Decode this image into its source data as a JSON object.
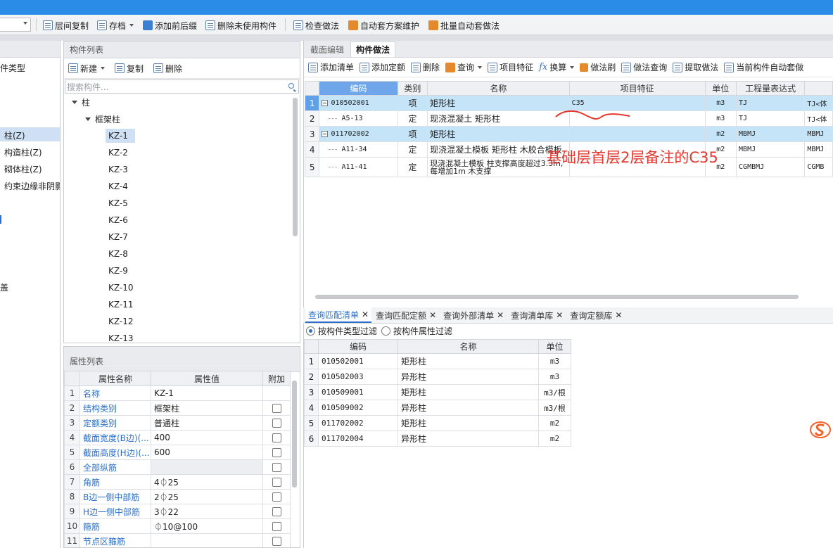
{
  "toolbar": {
    "items": [
      {
        "label": "层间复制",
        "icon": "copy-layers-icon"
      },
      {
        "label": "存档",
        "icon": "archive-icon"
      },
      {
        "label": "添加前后缀",
        "icon": "add-prefix-icon"
      },
      {
        "label": "删除未使用构件",
        "icon": "delete-unused-icon"
      },
      {
        "label": "检查做法",
        "icon": "check-method-icon"
      },
      {
        "label": "自动套方案维护",
        "icon": "auto-scheme-icon"
      },
      {
        "label": "批量自动套做法",
        "icon": "batch-auto-icon"
      }
    ]
  },
  "left_strip": {
    "items": [
      "件类型",
      "柱(Z)",
      "构造柱(Z)",
      "砌体柱(Z)",
      "约束边缘非阴影",
      "盖"
    ]
  },
  "component_list": {
    "title": "构件列表",
    "new_label": "新建",
    "copy_label": "复制",
    "delete_label": "删除",
    "search_placeholder": "搜索构件...",
    "root": "柱",
    "group": "框架柱",
    "items": [
      "KZ-1",
      "KZ-2",
      "KZ-3",
      "KZ-4",
      "KZ-5",
      "KZ-6",
      "KZ-7",
      "KZ-8",
      "KZ-9",
      "KZ-10",
      "KZ-11",
      "KZ-12",
      "KZ-13"
    ]
  },
  "attributes": {
    "title": "属性列表",
    "headers": [
      "属性名称",
      "属性值",
      "附加"
    ],
    "rows": [
      {
        "n": "1",
        "name": "名称",
        "value": "KZ-1"
      },
      {
        "n": "2",
        "name": "结构类别",
        "value": "框架柱"
      },
      {
        "n": "3",
        "name": "定额类别",
        "value": "普通柱"
      },
      {
        "n": "4",
        "name": "截面宽度(B边)(...",
        "value": "400"
      },
      {
        "n": "5",
        "name": "截面高度(H边)(...",
        "value": "600"
      },
      {
        "n": "6",
        "name": "全部纵筋",
        "value": ""
      },
      {
        "n": "7",
        "name": "角筋",
        "value": "4⏀25"
      },
      {
        "n": "8",
        "name": "B边一侧中部筋",
        "value": "2⏀25"
      },
      {
        "n": "9",
        "name": "H边一侧中部筋",
        "value": "3⏀22"
      },
      {
        "n": "10",
        "name": "箍筋",
        "value": "⏀10@100"
      },
      {
        "n": "11",
        "name": "节点区箍筋",
        "value": ""
      }
    ]
  },
  "right_tabs": [
    "截面编辑",
    "构件做法"
  ],
  "method_toolbar": {
    "items": [
      "添加清单",
      "添加定额",
      "删除",
      "查询",
      "项目特征",
      "换算",
      "做法刷",
      "做法查询",
      "提取做法",
      "当前构件自动套做"
    ]
  },
  "main_table": {
    "headers": [
      "编码",
      "类别",
      "名称",
      "项目特征",
      "单位",
      "工程量表达式",
      ""
    ],
    "rows": [
      {
        "n": "1",
        "code": "010502001",
        "type": "项",
        "name": "矩形柱",
        "feature": "C35",
        "unit": "m3",
        "expr": "TJ",
        "extra": "TJ<体"
      },
      {
        "n": "2",
        "code": "A5-13",
        "type": "定",
        "name": "现浇混凝土 矩形柱",
        "feature": "",
        "unit": "m3",
        "expr": "TJ",
        "extra": "TJ<体"
      },
      {
        "n": "3",
        "code": "011702002",
        "type": "项",
        "name": "矩形柱",
        "feature": "",
        "unit": "m2",
        "expr": "MBMJ",
        "extra": "MBMJ"
      },
      {
        "n": "4",
        "code": "A11-34",
        "type": "定",
        "name": "现浇混凝土模板 矩形柱 木胶合模板",
        "feature": "",
        "unit": "m2",
        "expr": "MBMJ",
        "extra": "MBMJ"
      },
      {
        "n": "5",
        "code": "A11-41",
        "type": "定",
        "name": "现浇混凝土模板 柱支撑高度超过3.3m,每增加1m 木支撑",
        "feature": "",
        "unit": "m2",
        "expr": "CGMBMJ",
        "extra": "CGMB"
      }
    ]
  },
  "annotation": "基础层首层2层备注的C35",
  "bottom_tabs": [
    "查询匹配清单",
    "查询匹配定额",
    "查询外部清单",
    "查询清单库",
    "查询定额库"
  ],
  "filters": [
    "按构件类型过滤",
    "按构件属性过滤"
  ],
  "query_table": {
    "headers": [
      "编码",
      "名称",
      "单位"
    ],
    "rows": [
      {
        "n": "1",
        "code": "010502001",
        "name": "矩形柱",
        "unit": "m3"
      },
      {
        "n": "2",
        "code": "010502003",
        "name": "异形柱",
        "unit": "m3"
      },
      {
        "n": "3",
        "code": "010509001",
        "name": "矩形柱",
        "unit": "m3/根"
      },
      {
        "n": "4",
        "code": "010509002",
        "name": "异形柱",
        "unit": "m3/根"
      },
      {
        "n": "5",
        "code": "011702002",
        "name": "矩形柱",
        "unit": "m2"
      },
      {
        "n": "6",
        "code": "011702004",
        "name": "异形柱",
        "unit": "m2"
      }
    ]
  },
  "colors": {
    "titlebar": "#2a8ce6",
    "accent": "#2a6fc8",
    "selected_row": "#c6e4f7",
    "annotation": "#e2372e"
  }
}
